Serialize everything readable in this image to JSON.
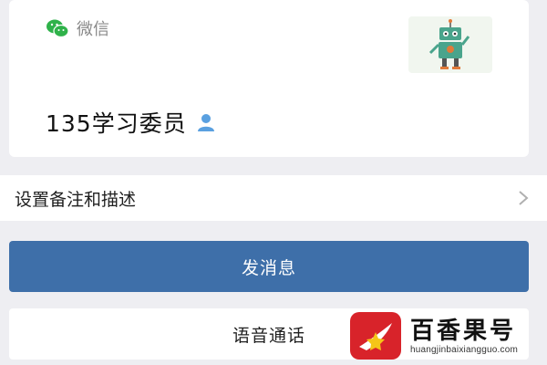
{
  "profile": {
    "source_label": "微信",
    "source_icon": "wechat-icon",
    "avatar_icon": "robot-avatar",
    "display_name": "135学习委员",
    "name_icon": "person-icon"
  },
  "remark_row": {
    "label": "设置备注和描述",
    "icon": "chevron-right-icon"
  },
  "actions": {
    "send_message": "发消息",
    "voice_call": "语音通话"
  },
  "watermark": {
    "title": "百香果号",
    "url": "huangjinbaixiangguo.com"
  },
  "colors": {
    "wechat_green": "#2fb24a",
    "primary_button": "#3e6fa9",
    "background": "#eeeef2",
    "person_icon": "#5aa0e0",
    "watermark_red": "#d8232a"
  }
}
